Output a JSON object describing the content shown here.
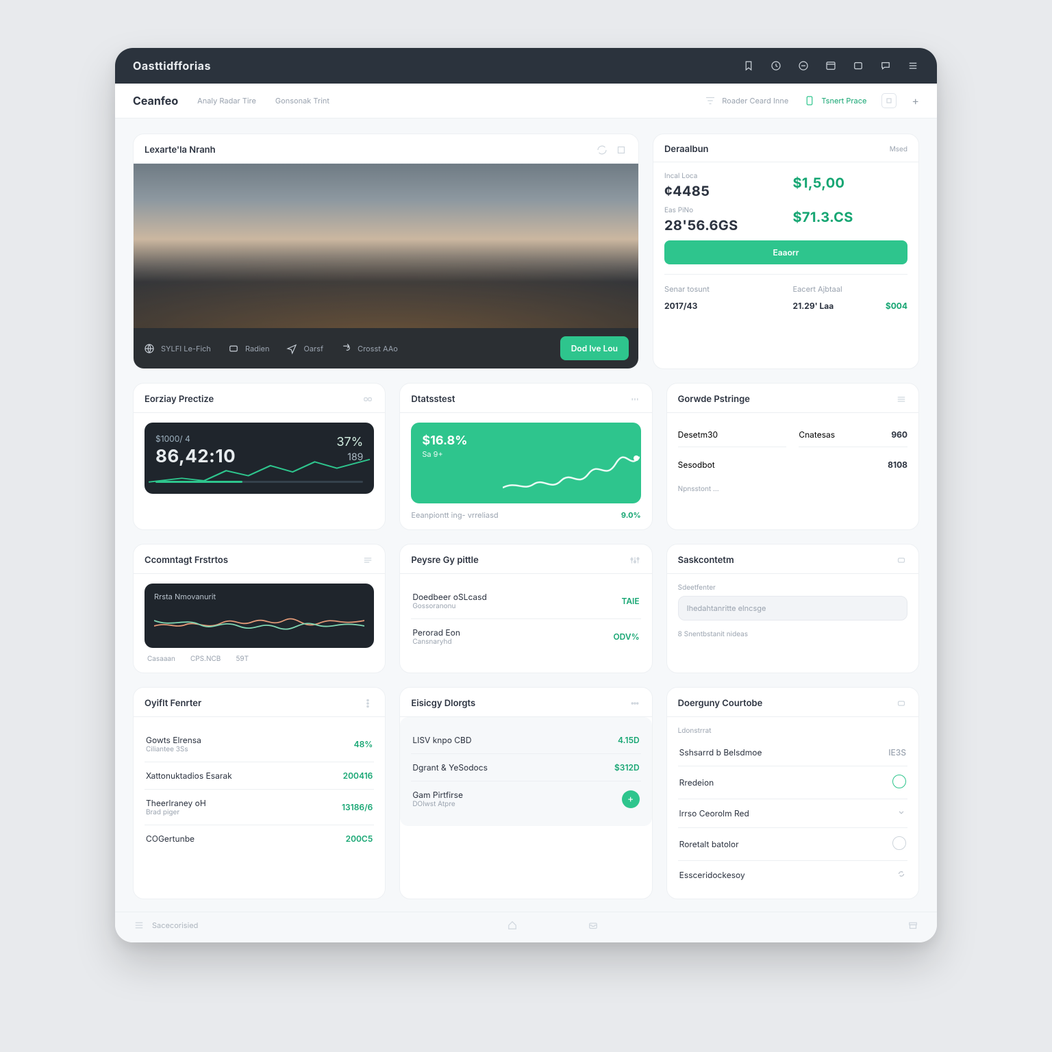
{
  "appbar": {
    "brand": "Oasttidfforias"
  },
  "subbar": {
    "title": "Ceanfeo",
    "links": [
      "Analy Radar Tire",
      "Gonsonak Trint"
    ],
    "filter": "Roader Ceard Inne",
    "export": "Tsnert Prace"
  },
  "hero": {
    "title": "Lexarte'la Nranh",
    "chips": [
      "SYLFI Le-Fich",
      "Radien",
      "Oarsf",
      "Crosst AAo"
    ],
    "cta": "Dod Ive Lou"
  },
  "summary": {
    "title": "Deraalbun",
    "action": "Msed",
    "k1_label": "Incal Loca",
    "k1_value": "¢4485",
    "k2_label": "",
    "k2_value": "$1,5,00",
    "k3_label": "Eas PiNo",
    "k3_value": "28'56.6GS",
    "k4_label": "",
    "k4_value": "$71.3.CS",
    "button": "Eaaorr",
    "m1_label": "Senar tosunt",
    "m1_value": "2017/43",
    "m2_label": "Eacert Ajbtaal",
    "m2_value": "21.29' Laa",
    "m3_label": "",
    "m3_value": "$004"
  },
  "row2": {
    "left": {
      "title": "Eorziay Prectize",
      "amt_label": "$1000/ 4",
      "amt": "86,42:10",
      "side_top": "37%",
      "side_bottom": "189"
    },
    "mid": {
      "title": "Dtatsstest",
      "g1": "$16.8%",
      "g2": "Sa 9+",
      "foot_l": "Eeanpiontt ing- vrreliasd",
      "foot_r": "9.0%"
    },
    "right": {
      "title": "Gorwde Pstringe",
      "rows": [
        {
          "l": "Desetm30",
          "r": "Cnatesas",
          "v": "960"
        },
        {
          "l": "Sesodbot",
          "r": "",
          "v": "8108"
        }
      ],
      "foot": "Npnsstont …"
    }
  },
  "row3": {
    "left": {
      "title": "Ccomntagt Frstrtos",
      "mov_title": "Rrsta Nmovanurit",
      "legend": [
        "Casaaan",
        "CPS.NCB",
        "59T"
      ]
    },
    "mid": {
      "title": "Peysre Gy pittle",
      "rows": [
        {
          "l": "Doedbeer oSLcasd",
          "s": "Gossoranonu",
          "r": "TAIE"
        },
        {
          "l": "Perorad Eon",
          "s": "Cansnaryhd",
          "r": "ODV%"
        }
      ]
    },
    "right": {
      "title": "Saskcontetm",
      "ph_label": "Sdeetfenter",
      "ph": "Ihedahtanritte elncsge",
      "foot": "8  Snentbstanit nideas"
    }
  },
  "row4": {
    "left": {
      "title": "Oyiflt Fenrter",
      "rows": [
        {
          "l": "Gowts Elrensa",
          "s": "Ciliantee 3Ss",
          "r": "48%"
        },
        {
          "l": "Xattonuktadios Esarak",
          "s": "",
          "r": "200416"
        },
        {
          "l": "Theerlraney oH",
          "s": "Brad piger",
          "r": "13186/6"
        },
        {
          "l": "COGertunbe",
          "s": "",
          "r": "200C5"
        }
      ]
    },
    "mid": {
      "title": "Eisicgy Dlorgts",
      "rows": [
        {
          "l": "LISV knpo CBD",
          "r": "4.15D"
        },
        {
          "l": "Dgrant & YeSodocs",
          "r": "$312D"
        },
        {
          "l": "Gam Pirtfirse",
          "s": "DOlwst Atpre",
          "fab": true
        }
      ]
    },
    "right": {
      "title": "Doerguny Courtobe",
      "sub": "Ldonstrrat",
      "rows": [
        {
          "l": "Sshsarrd b Belsdmoe",
          "r": "IE3S",
          "kind": "text"
        },
        {
          "l": "Rredeion",
          "kind": "ring-accent"
        },
        {
          "l": "lrrso Ceorolm Red",
          "kind": "chev"
        },
        {
          "l": "Roretalt batolor",
          "kind": "ring"
        },
        {
          "l": "Essceridockesoy",
          "kind": "refresh"
        }
      ]
    }
  },
  "footer": {
    "label": "Sacecorisied"
  }
}
